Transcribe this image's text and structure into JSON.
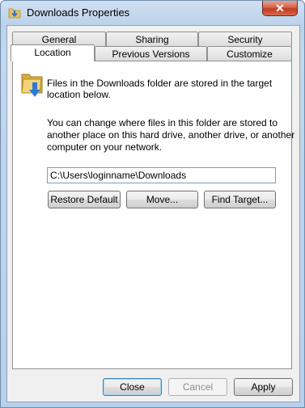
{
  "window": {
    "title": "Downloads Properties",
    "close_glyph": "✕"
  },
  "tabs_row1": [
    {
      "label": "General"
    },
    {
      "label": "Sharing"
    },
    {
      "label": "Security"
    }
  ],
  "tabs_row2": [
    {
      "label": "Location",
      "active": true
    },
    {
      "label": "Previous Versions"
    },
    {
      "label": "Customize"
    }
  ],
  "location": {
    "info_line1": "Files in the Downloads folder are stored in the target",
    "info_line2": "location below.",
    "change_line1": "You can change where files in this folder are stored to",
    "change_line2": "another place on this hard drive, another drive, or another",
    "change_line3": "computer on your network.",
    "path_value": "C:\\Users\\loginname\\Downloads",
    "buttons": {
      "restore_default": "Restore Default",
      "move": "Move...",
      "find_target": "Find Target..."
    }
  },
  "footer": {
    "close": "Close",
    "cancel": "Cancel",
    "apply": "Apply"
  },
  "colors": {
    "accent": "#3c7fb1",
    "close_button": "#c13a22"
  },
  "icons": {
    "title": "downloads-folder-icon",
    "folder": "downloads-folder-icon"
  }
}
